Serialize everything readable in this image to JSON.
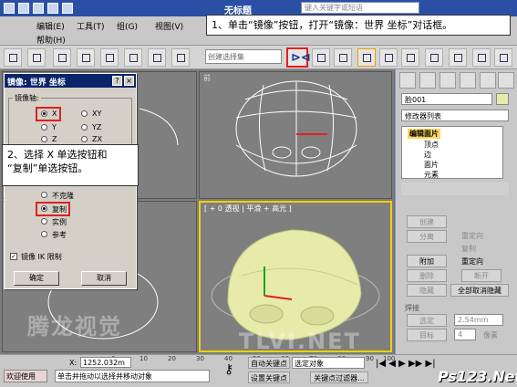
{
  "window": {
    "title": "无标题",
    "search_placeholder": "键入关键字或短语"
  },
  "menu": [
    "编辑(E)",
    "工具(T)",
    "组(G)",
    "视图(V)",
    "帮助(H)"
  ],
  "toolbar": {
    "selection_set_placeholder": "创建选择集"
  },
  "dialog": {
    "title": "镜像: 世界 坐标",
    "help_btn": "?",
    "close_btn": "×",
    "mirror_axis_label": "镜像轴:",
    "axes": [
      {
        "label": "X",
        "selected": true
      },
      {
        "label": "XY",
        "selected": false
      },
      {
        "label": "Y",
        "selected": false
      },
      {
        "label": "YZ",
        "selected": false
      },
      {
        "label": "Z",
        "selected": false
      },
      {
        "label": "ZX",
        "selected": false
      }
    ],
    "clone_options": [
      {
        "label": "不克隆",
        "selected": false
      },
      {
        "label": "复制",
        "selected": true
      },
      {
        "label": "实例",
        "selected": false
      },
      {
        "label": "参考",
        "selected": false
      }
    ],
    "ik_limit": "镜像 IK 限制",
    "ok_btn": "确定",
    "cancel_btn": "取消"
  },
  "callouts": {
    "step1": "1、单击“镜像”按钮，打开“镜像：世界 坐标”对话框。",
    "step2_line1": "2、选择 X 单选按钮和",
    "step2_line2": "“复制”单选按钮。"
  },
  "viewports": {
    "perspective_label": "[ + 0 透视 | 平滑 + 高光 ]",
    "front_label": "前"
  },
  "panel": {
    "object_name": "脸001",
    "modifier_list": "修改器列表",
    "stack_root": "编辑面片",
    "stack_items": [
      "顶点",
      "边",
      "面片",
      "元素"
    ],
    "buttons": {
      "create": "创建",
      "detach": "分离",
      "reorient": "重定向",
      "copy": "复制",
      "attach": "附加",
      "reorient2": "重定向",
      "delete": "删除",
      "break": "断开",
      "hide": "隐藏",
      "unhide_all": "全部取消隐藏",
      "weld_label": "焊接",
      "threshold": "选定",
      "threshold_value": "2.54mm",
      "target": "目标",
      "target_value": "4",
      "pixels": "像素"
    }
  },
  "bottom": {
    "timeline_ticks": [
      "0",
      "10",
      "20",
      "30",
      "40",
      "50",
      "60",
      "70",
      "80",
      "90",
      "100"
    ],
    "welcome": "欢迎使用",
    "status_hint": "单击并拖动以选择并移动对象",
    "x_label": "X:",
    "x_value": "1252.032m",
    "auto_key": "自动关键点",
    "set_key": "设置关键点",
    "selected": "选定对象",
    "key_filters": "关键点过滤器...",
    "watermark": "TLVI.NET",
    "watermark2": "腾龙视觉",
    "brand": "Ps123.Net"
  },
  "colors": {
    "title_bar": "#2a4fa5",
    "highlight": "#e02020",
    "dialog_title": "#0a246a",
    "mesh_fill": "#e6ebaa"
  }
}
